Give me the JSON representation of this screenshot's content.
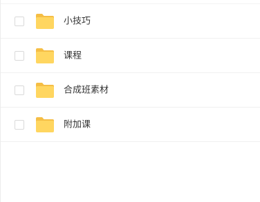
{
  "colors": {
    "folder_body": "#FFD660",
    "folder_tab": "#F5BE45",
    "text": "#333333",
    "checkbox_border": "#D9D9D9"
  },
  "file_list": {
    "items": [
      {
        "name": "小技巧",
        "icon": "folder-icon",
        "checked": false
      },
      {
        "name": "课程",
        "icon": "folder-icon",
        "checked": false
      },
      {
        "name": "合成班素材",
        "icon": "folder-icon",
        "checked": false
      },
      {
        "name": "附加课",
        "icon": "folder-icon",
        "checked": false
      }
    ]
  }
}
